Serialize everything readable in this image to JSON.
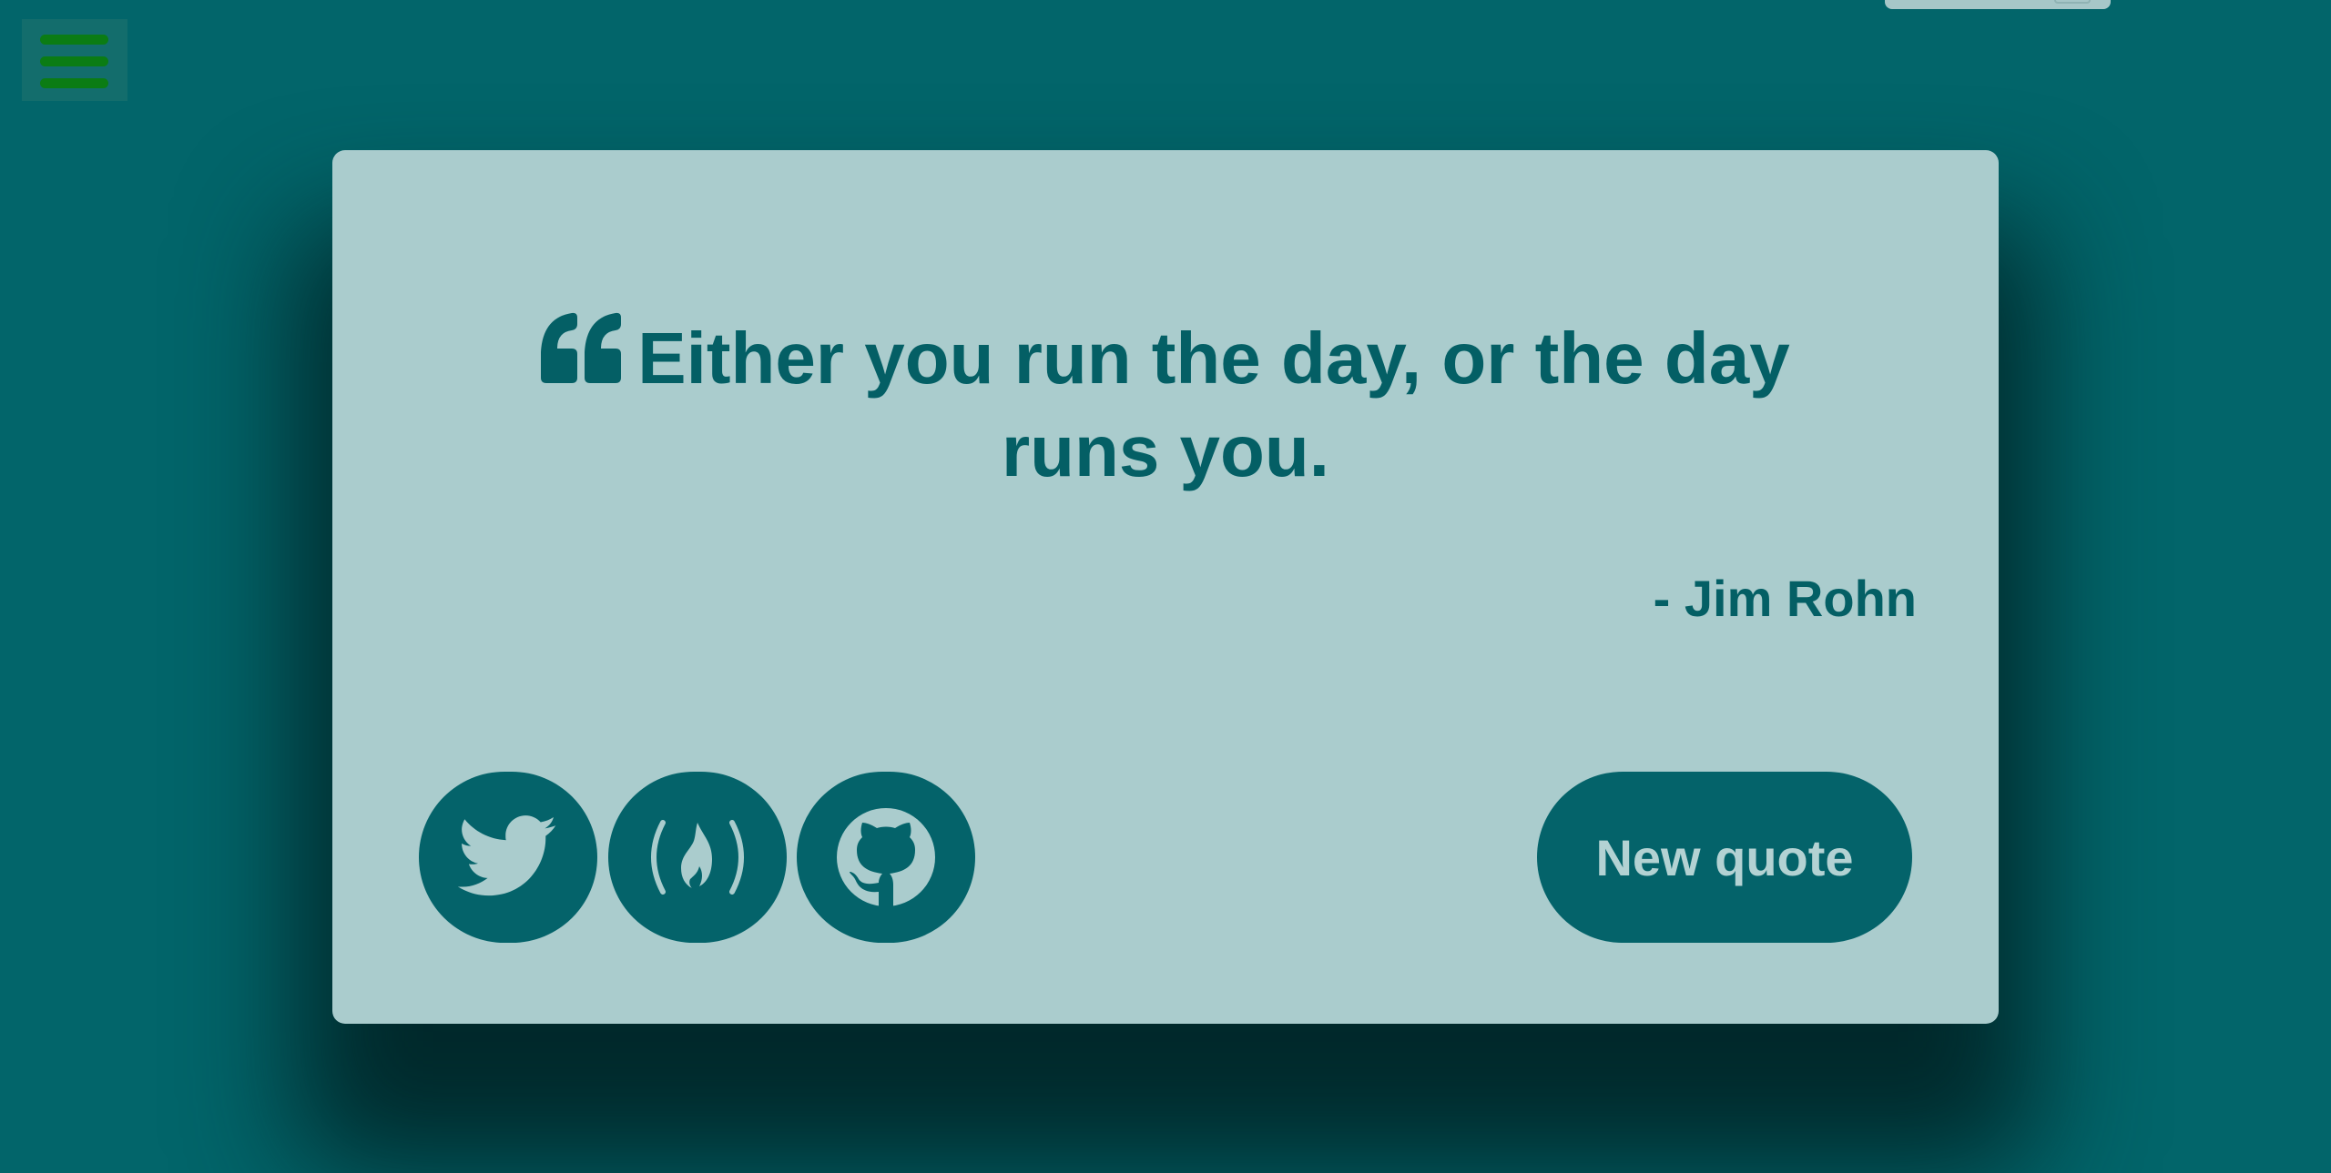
{
  "menu": {
    "icon": "hamburger-menu-icon",
    "color": "#0b7c14"
  },
  "card": {
    "quote_text": "Either you run the day, or the day runs you.",
    "author": "- Jim Rohn",
    "quote_icon": "quote-left-icon",
    "new_quote_label": "New quote",
    "social": [
      {
        "name": "twitter",
        "icon": "twitter-icon"
      },
      {
        "name": "freecodecamp",
        "icon": "freecodecamp-icon"
      },
      {
        "name": "github",
        "icon": "github-icon"
      }
    ]
  },
  "colors": {
    "background": "#02656a",
    "card": "#aacccd",
    "accent": "#045f65",
    "button_text": "#b3d2d3"
  }
}
